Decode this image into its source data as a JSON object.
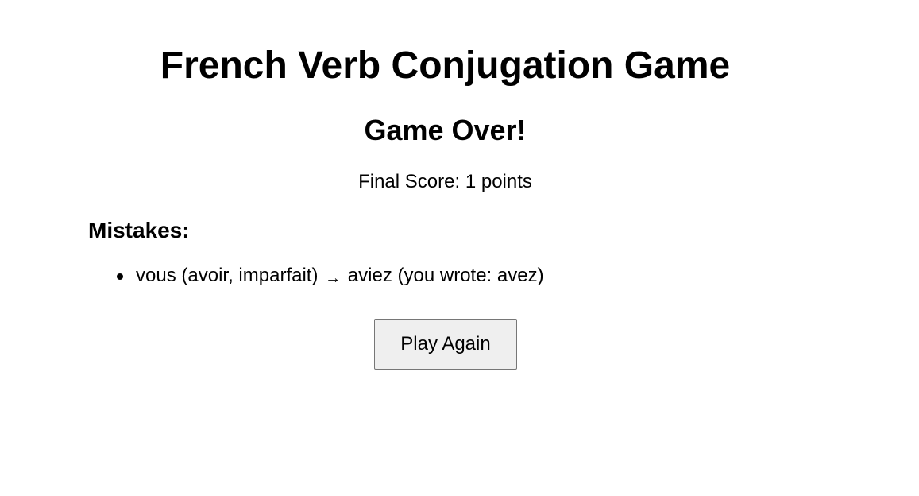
{
  "header": {
    "title": "French Verb Conjugation Game"
  },
  "result": {
    "heading": "Game Over!",
    "score_label": "Final Score:",
    "score_value": "1",
    "score_unit": "points"
  },
  "mistakes": {
    "heading": "Mistakes:",
    "items": [
      {
        "pronoun": "vous",
        "verb": "avoir",
        "tense": "imparfait",
        "correct": "aviez",
        "you_wrote_label": "you wrote:",
        "user_answer": "avez",
        "arrow": "→"
      }
    ]
  },
  "actions": {
    "play_again_label": "Play Again"
  }
}
